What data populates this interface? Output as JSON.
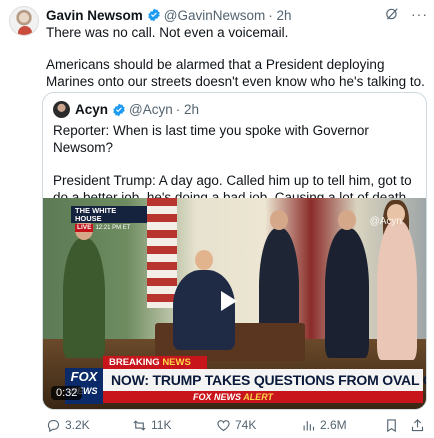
{
  "author": {
    "name": "Gavin Newsom",
    "handle": "@GavinNewsom",
    "time": "· 2h"
  },
  "tweet": {
    "line1": "There was no call. Not even a voicemail.",
    "line2": "Americans should be alarmed that a President deploying Marines onto our streets doesn't even know who he's talking to."
  },
  "quote": {
    "name": "Acyn",
    "handle": "@Acyn",
    "time": "· 2h",
    "line1": "Reporter: When is last time you spoke with Governor Newsom?",
    "line2": "President Trump: A day ago. Called him up to tell him, got to do a better job, he's doing a bad job. Causing a lot of death and potential death"
  },
  "video": {
    "bug_title": "THE WHITE HOUSE",
    "bug_live": "LIVE",
    "bug_time": "12:21 PM ET",
    "watermark": "@Acyn",
    "breaking_word": "BREAKING",
    "breaking_news": "NEWS",
    "headline": "NOW: TRUMP TAKES QUESTIONS FROM OVAL OFFICE",
    "alert_brand": "FOX NEWS",
    "alert_word": "ALERT",
    "logo_top": "FOX",
    "logo_bottom": "NEWS",
    "duration": "0:32"
  },
  "actions": {
    "replies": "3.2K",
    "reposts": "11K",
    "likes": "74K",
    "views": "2.6M"
  },
  "colors": {
    "verified": "#1d9bf0",
    "muted": "#536471",
    "fox_red": "#c8151b"
  }
}
